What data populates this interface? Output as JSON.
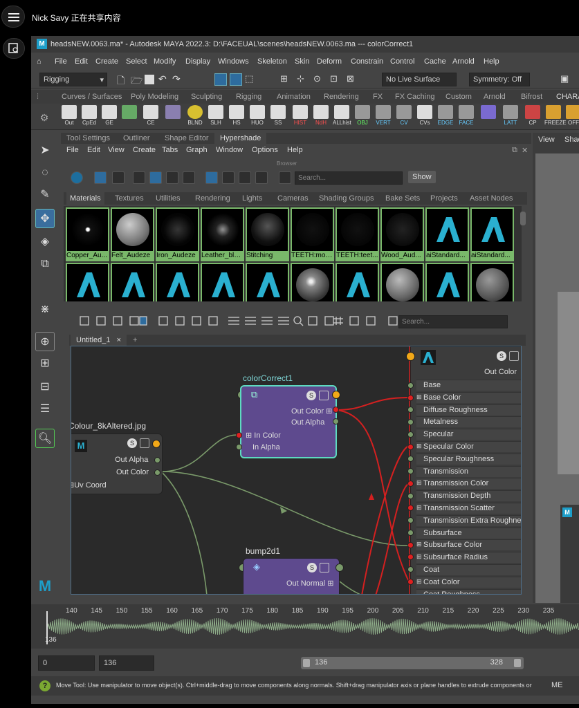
{
  "share": {
    "text": "Nick Savy 正在共享内容"
  },
  "window": {
    "title": "headsNEW.0063.ma* - Autodesk MAYA 2022.3: D:\\FACEUAL\\scenes\\headsNEW.0063.ma   ---   colorCorrect1"
  },
  "main_menu": [
    "File",
    "Edit",
    "Create",
    "Select",
    "Modify",
    "Display",
    "Windows",
    "Skeleton",
    "Skin",
    "Deform",
    "Constrain",
    "Control",
    "Cache",
    "Arnold",
    "Help"
  ],
  "status_line": {
    "mode": "Rigging",
    "live_surface": "No Live Surface",
    "symmetry": "Symmetry: Off"
  },
  "shelf_tabs": [
    "Curves / Surfaces",
    "Poly Modeling",
    "Sculpting",
    "Rigging",
    "Animation",
    "Rendering",
    "FX",
    "FX Caching",
    "Custom",
    "Arnold",
    "Bifrost",
    "CHARA"
  ],
  "shelf_buttons": [
    "Out",
    "CpEd",
    "GE",
    "",
    "CE",
    "",
    "BLND",
    "SLH",
    "HS",
    "HUO",
    "SS",
    "HIST",
    "NdH",
    "ALLhist",
    "OBJ",
    "VERT",
    "CV",
    "CVs",
    "EDGE",
    "FACE",
    "",
    "LATT",
    "CP",
    "FREEZE",
    "OFF"
  ],
  "panel_tabs": [
    "Tool Settings",
    "Outliner",
    "Shape Editor",
    "Hypershade"
  ],
  "hs_menu": [
    "File",
    "Edit",
    "View",
    "Create",
    "Tabs",
    "Graph",
    "Window",
    "Options",
    "Help"
  ],
  "browser": {
    "label": "Browser",
    "search_placeholder": "Search...",
    "show": "Show",
    "tabs": [
      "Materials",
      "Textures",
      "Utilities",
      "Rendering",
      "Lights",
      "Cameras",
      "Shading Groups",
      "Bake Sets",
      "Projects",
      "Asset Nodes"
    ],
    "row1": [
      "Copper_Au...",
      "Felt_Audeze",
      "Iron_Audeze",
      "Leather_black",
      "Stitching",
      "TEETH:mou...",
      "TEETH:teet...",
      "Wood_Aud...",
      "aiStandard...",
      "aiStandard..."
    ]
  },
  "node_editor": {
    "tab": "Untitled_1",
    "tab_close": "×",
    "tab_add": "+",
    "search_placeholder": "Search...",
    "file_node": {
      "title": "Colour_8kAltered.jpg",
      "ports": [
        "Out Alpha",
        "Out Color",
        "Uv Coord"
      ]
    },
    "cc_node": {
      "title": "colorCorrect1",
      "ports": [
        "Out Color",
        "Out Alpha",
        "In Color",
        "In Alpha"
      ]
    },
    "bump_node": {
      "title": "bump2d1",
      "ports": [
        "Out Normal"
      ]
    },
    "ai_node": {
      "out": "Out Color",
      "ports": [
        "Base",
        "Base Color",
        "Diffuse Roughness",
        "Metalness",
        "Specular",
        "Specular Color",
        "Specular Roughness",
        "Transmission",
        "Transmission Color",
        "Transmission Depth",
        "Transmission Scatter",
        "Transmission Extra Roughnes",
        "Subsurface",
        "Subsurface Color",
        "Subsurface Radius",
        "Coat",
        "Coat Color",
        "Coat Roughness"
      ]
    }
  },
  "timeline": {
    "ticks": [
      "140",
      "145",
      "150",
      "155",
      "160",
      "165",
      "170",
      "175",
      "180",
      "185",
      "190",
      "195",
      "200",
      "205",
      "210",
      "215",
      "220",
      "225",
      "230",
      "235"
    ],
    "current": "136"
  },
  "range": {
    "start": "0",
    "anim_start": "136",
    "range_start": "136",
    "range_end": "328",
    "right": "ME"
  },
  "help_line": "Move Tool: Use manipulator to move object(s). Ctrl+middle-drag to move components along normals. Shift+drag manipulator axis or plane handles to extrude components or",
  "viewport": {
    "menu": "View",
    "menu2": "Shad"
  },
  "colors": {
    "accent": "#1d9ec9",
    "node_purple": "#5e4a8e",
    "connection_red": "#d42020",
    "connection_green": "#7a9a6a",
    "swatch_green": "#79b86a"
  }
}
